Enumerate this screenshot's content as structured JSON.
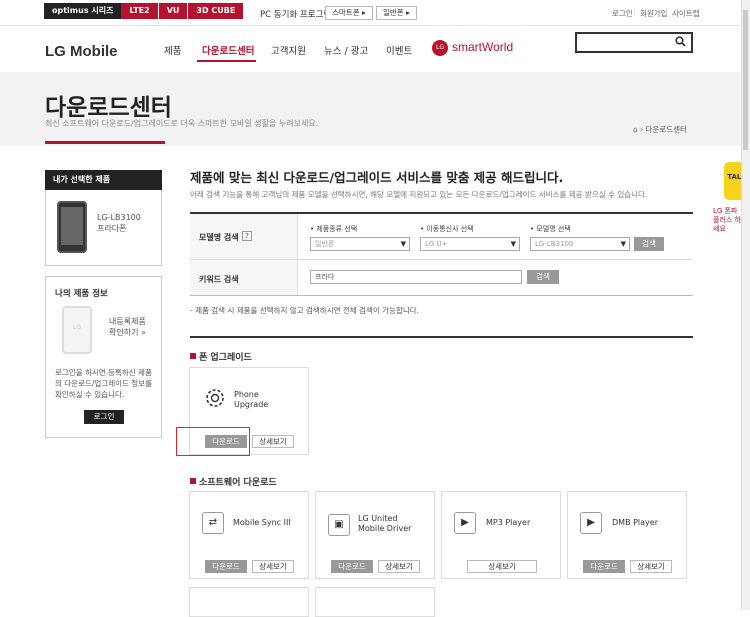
{
  "topbar": {
    "brands": [
      "optimus 시리즈",
      "LTE2",
      "VU",
      "3D CUBE"
    ],
    "pc_sync_label": "PC 동기화 프로그램",
    "smartphone_btn": "스마트폰 ▸",
    "featurephone_btn": "일반폰 ▸",
    "links": [
      "로그인",
      "회원가입",
      "사이트맵"
    ]
  },
  "header": {
    "logo": "LG Mobile",
    "nav": [
      "제품",
      "다운로드센터",
      "고객지원",
      "뉴스 / 광고",
      "이벤트"
    ],
    "active_nav": "다운로드센터",
    "smartworld": "smartWorld",
    "lg_mark": "LG",
    "search_icon": "search-icon"
  },
  "hero": {
    "title": "다운로드센터",
    "subtitle": "최신 소프트웨어 다운로드/업그레이드로 더욱 스마트한 모바일 생활을 누려보세요.",
    "breadcrumb": "⌂ › 다운로드센터"
  },
  "sidebar": {
    "selected_header": "내가 선택한 제품",
    "selected_model": "LG-LB3100",
    "selected_name": "프라다폰",
    "info_title": "나의 제품 정보",
    "info_link_1": "내등록제품",
    "info_link_2": "확인하기 »",
    "info_text": "로그인을 하시면 등록하신 제품의 다운로드/업그레이드 정보를 확인하실 수 있습니다.",
    "login_btn": "로그인",
    "phone_logo": "LG"
  },
  "main": {
    "title": "제품에 맞는 최신 다운로드/업그레이드 서비스를 맞춤 제공 해드립니다.",
    "subtitle": "아래 검색 기능을 통해 고객님의 제품 모델을 선택하시면, 해당 모델에 지원되고 있는 모든 다운로드/업그레이드 서비스를 제공 받으실 수 있습니다.",
    "model_search_label": "모델명 검색",
    "qmark": "?",
    "col1_label": "• 제품종류 선택",
    "col2_label": "• 이동통신사 선택",
    "col3_label": "• 모델명 선택",
    "col1_value": "일반폰",
    "col2_value": "LG U+",
    "col3_value": "LG-LB3100",
    "search_btn": "검색",
    "keyword_label": "키워드 검색",
    "keyword_value": "프라다",
    "keyword_search_btn": "검색",
    "note": "- 제품 검색 시 제품을 선택하지 않고 검색하시면 전체 검색이 가능합니다."
  },
  "phone_upgrade": {
    "section_title": "폰 업그레이드",
    "card_name_1": "Phone",
    "card_name_2": "Upgrade",
    "download_btn": "다운로드",
    "detail_btn": "상세보기"
  },
  "software": {
    "section_title": "소프트웨어 다운로드",
    "cards": [
      {
        "name_1": "Mobile Sync III",
        "name_2": "",
        "icon": "⇄",
        "download": "다운로드",
        "detail": "상세보기"
      },
      {
        "name_1": "LG United",
        "name_2": "Mobile Driver",
        "icon": "▣",
        "download": "다운로드",
        "detail": "상세보기"
      },
      {
        "name_1": "MP3 Player",
        "name_2": "",
        "icon": "▶",
        "download": "",
        "detail": "상세보기"
      },
      {
        "name_1": "DMB Player",
        "name_2": "",
        "icon": "▶",
        "download": "다운로드",
        "detail": "상세보기"
      }
    ]
  },
  "floating": {
    "talk": "TALK",
    "text": "LG 폰파 플러스 하세요"
  },
  "colors": {
    "accent": "#b5122f",
    "dark": "#222222",
    "highlight": "#e2222c"
  }
}
